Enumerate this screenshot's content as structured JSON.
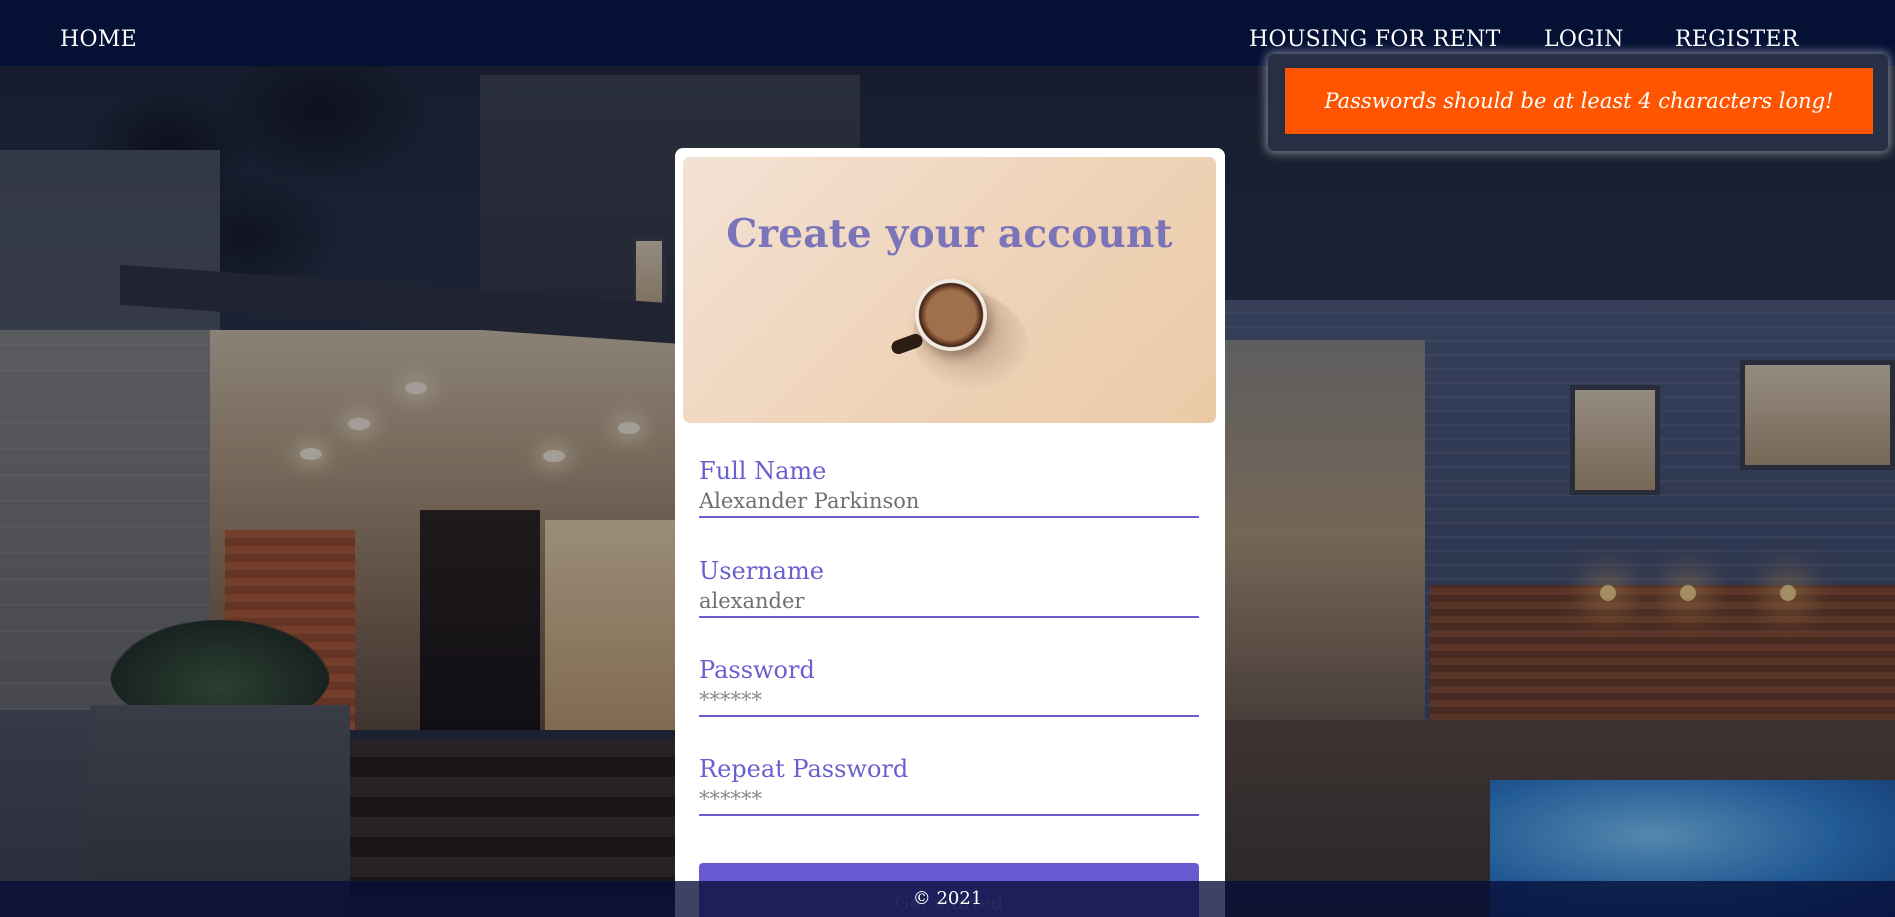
{
  "nav": {
    "home": "HOME",
    "housing": "HOUSING FOR RENT",
    "login": "LOGIN",
    "register": "REGISTER"
  },
  "notification": {
    "message": "Passwords should be at least 4 characters long!",
    "color": "#ff5500"
  },
  "card": {
    "title": "Create your account",
    "fields": [
      {
        "label": "Full Name",
        "value": "Alexander Parkinson",
        "placeholder": ""
      },
      {
        "label": "Username",
        "value": "alexander",
        "placeholder": ""
      },
      {
        "label": "Password",
        "value": "",
        "placeholder": "******"
      },
      {
        "label": "Repeat Password",
        "value": "",
        "placeholder": "******"
      }
    ],
    "submit_label": "Get started"
  },
  "footer": {
    "text": "© 2021"
  },
  "colors": {
    "accent": "#6a5fcf",
    "nav_bg": "#041036",
    "title": "#7b74b8"
  }
}
